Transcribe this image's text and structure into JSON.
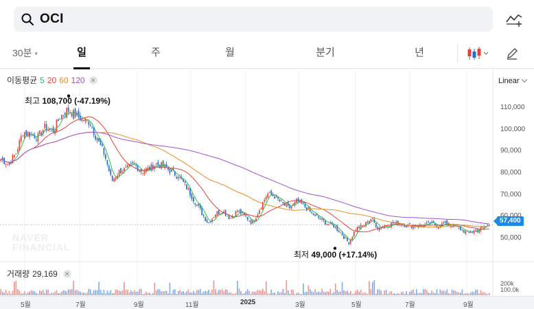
{
  "search": {
    "query": "OCI",
    "icon": "search-icon"
  },
  "header": {
    "compare_icon": "compare-chart-icon"
  },
  "tabs": {
    "minute_label": "30분",
    "items": [
      "일",
      "주",
      "월",
      "분기",
      "년"
    ],
    "active": "일",
    "candle_icon": "candlestick-icon",
    "draw_icon": "pencil-icon"
  },
  "moving_average": {
    "label": "이동평균",
    "periods": [
      {
        "period": "5",
        "color": "#2bbd4f"
      },
      {
        "period": "20",
        "color": "#e5433a"
      },
      {
        "period": "60",
        "color": "#f08c1d"
      },
      {
        "period": "120",
        "color": "#a04fd6"
      }
    ]
  },
  "scale": {
    "label": "Linear"
  },
  "price_axis": [
    "110,000",
    "100,000",
    "90,000",
    "80,000",
    "70,000",
    "60,000",
    "50,000"
  ],
  "annotations": {
    "high_prefix": "최고",
    "high_value": "108,700",
    "high_change": "(-47.19%)",
    "low_prefix": "최저",
    "low_value": "49,000",
    "low_change": "(+17.14%)"
  },
  "last_price": "57,400",
  "watermark": {
    "line1": "NAVER",
    "line2": "FINANCIAL"
  },
  "volume": {
    "label": "거래량",
    "value": "29,169",
    "axis": [
      "200k",
      "100.0k"
    ]
  },
  "time_axis": [
    {
      "label": "5월",
      "year": false
    },
    {
      "label": "7월",
      "year": false
    },
    {
      "label": "9월",
      "year": false
    },
    {
      "label": "11월",
      "year": false
    },
    {
      "label": "2025",
      "year": true
    },
    {
      "label": "3월",
      "year": false
    },
    {
      "label": "5월",
      "year": false
    },
    {
      "label": "7월",
      "year": false
    },
    {
      "label": "9월",
      "year": false
    }
  ],
  "colors": {
    "up": "#e5433a",
    "down": "#1e6fd9",
    "last_price_bg": "#1e88e5"
  },
  "chart_data": {
    "type": "candlestick",
    "y_range": [
      45000,
      115000
    ],
    "high": 108700,
    "low": 49000,
    "close_path": [
      84000,
      82000,
      86000,
      95000,
      94000,
      93000,
      97000,
      95000,
      101000,
      104000,
      102000,
      100000,
      99000,
      92000,
      86000,
      75000,
      79000,
      80000,
      82000,
      79000,
      80000,
      82000,
      81000,
      79000,
      77000,
      73000,
      68000,
      63000,
      58000,
      62000,
      63000,
      60000,
      63000,
      61000,
      58000,
      64000,
      70000,
      69000,
      66000,
      64000,
      67000,
      65000,
      62000,
      60000,
      58000,
      57000,
      54000,
      50000,
      56000,
      57000,
      60000,
      56000,
      57000,
      58000,
      58000,
      57000,
      57000,
      57000,
      58000,
      57000,
      58000,
      57000,
      56000,
      54000,
      55000,
      56000,
      57400
    ]
  }
}
